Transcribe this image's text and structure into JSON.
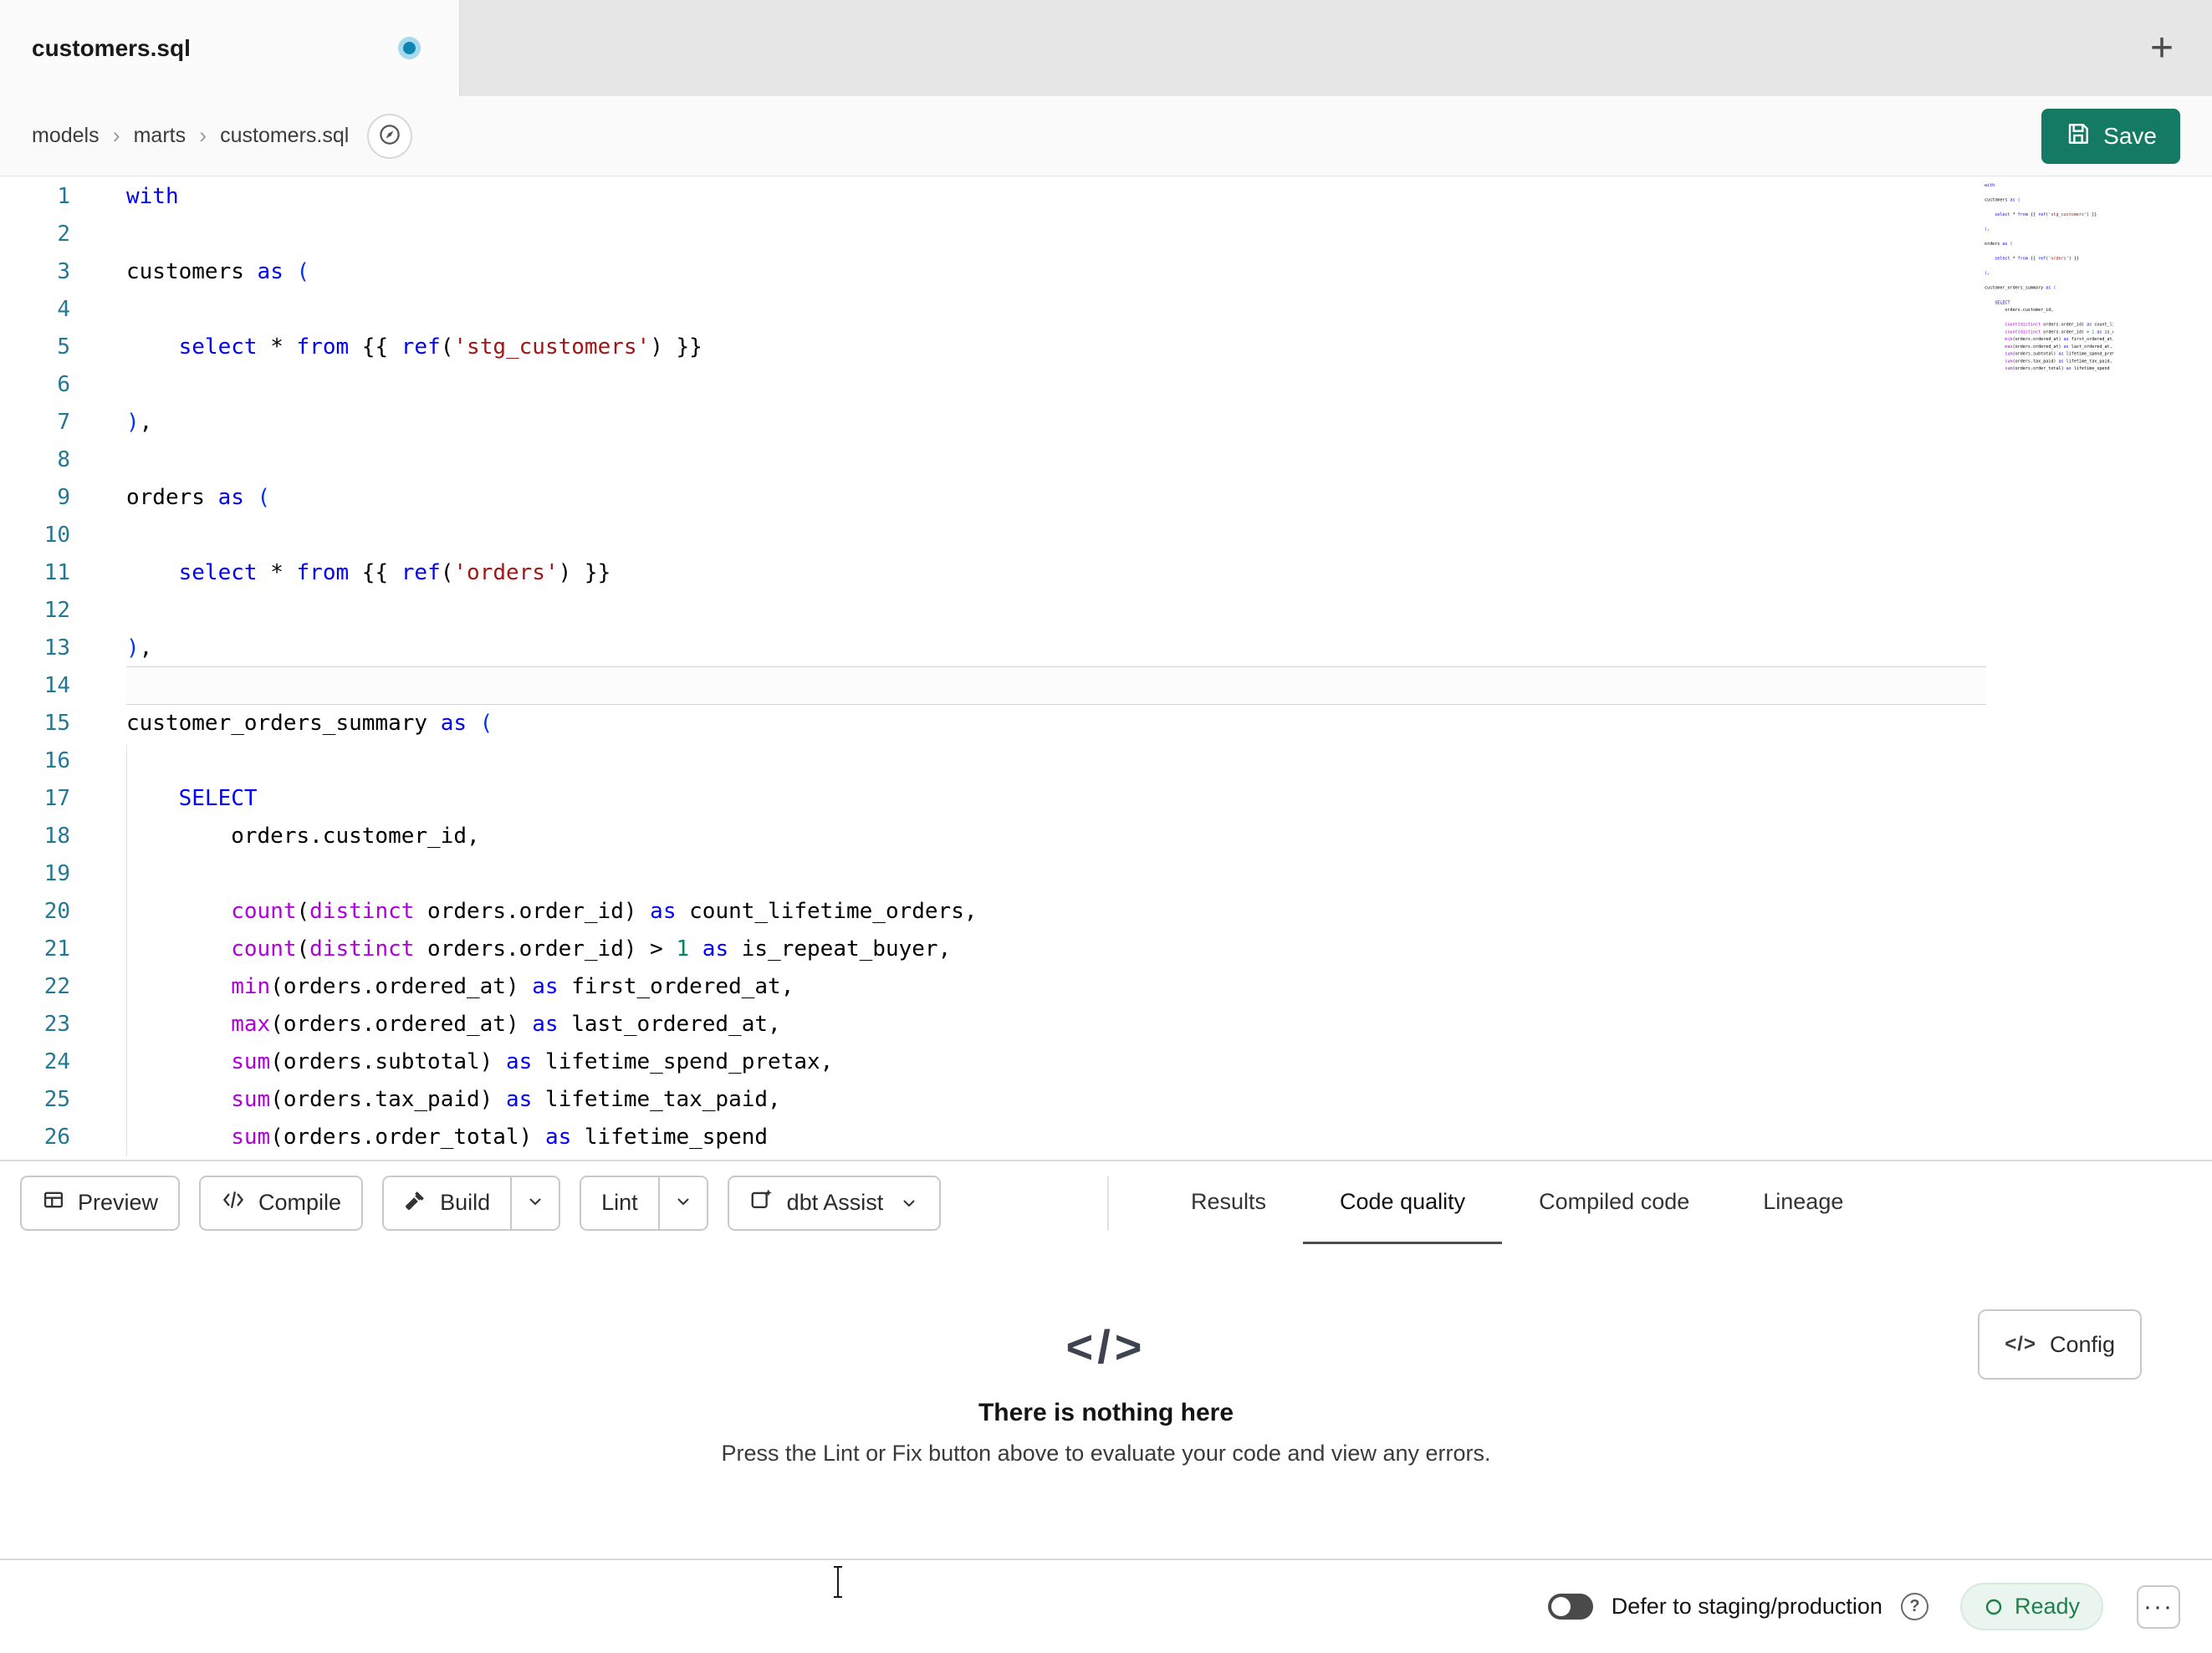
{
  "colors": {
    "accent_save": "#147a63",
    "kw": "#0000ff",
    "fn": "#af00db",
    "str": "#a31515",
    "num": "#098658",
    "br": "#0431fa",
    "line_number": "#237893",
    "ready_green": "#1d7f4c"
  },
  "icons": {
    "plus": "+",
    "breadcrumb_sep": "›",
    "code": "</>",
    "help": "?",
    "menu": "···"
  },
  "tab_bar": {
    "tab_title": "customers.sql"
  },
  "breadcrumb": {
    "items": [
      "models",
      "marts",
      "customers.sql"
    ]
  },
  "header": {
    "save_label": "Save"
  },
  "editor": {
    "active_line": 14,
    "lines": [
      [
        [
          "kw",
          "with"
        ]
      ],
      [],
      [
        [
          "id",
          "customers "
        ],
        [
          "kw",
          "as"
        ],
        [
          "id",
          " "
        ],
        [
          "br",
          "("
        ]
      ],
      [],
      [
        [
          "id",
          "    "
        ],
        [
          "kw",
          "select"
        ],
        [
          "id",
          " * "
        ],
        [
          "kw",
          "from"
        ],
        [
          "id",
          " {{ "
        ],
        [
          "kw",
          "ref"
        ],
        [
          "id",
          "("
        ],
        [
          "str",
          "'stg_customers'"
        ],
        [
          "id",
          ") }}"
        ]
      ],
      [],
      [
        [
          "br",
          ")"
        ],
        [
          "id",
          ","
        ]
      ],
      [],
      [
        [
          "id",
          "orders "
        ],
        [
          "kw",
          "as"
        ],
        [
          "id",
          " "
        ],
        [
          "br",
          "("
        ]
      ],
      [],
      [
        [
          "id",
          "    "
        ],
        [
          "kw",
          "select"
        ],
        [
          "id",
          " * "
        ],
        [
          "kw",
          "from"
        ],
        [
          "id",
          " {{ "
        ],
        [
          "kw",
          "ref"
        ],
        [
          "id",
          "("
        ],
        [
          "str",
          "'orders'"
        ],
        [
          "id",
          ") }}"
        ]
      ],
      [],
      [
        [
          "br",
          ")"
        ],
        [
          "id",
          ","
        ]
      ],
      [],
      [
        [
          "id",
          "customer_orders_summary "
        ],
        [
          "kw",
          "as"
        ],
        [
          "id",
          " "
        ],
        [
          "br",
          "("
        ]
      ],
      [],
      [
        [
          "id",
          "    "
        ],
        [
          "kw",
          "SELECT"
        ]
      ],
      [
        [
          "id",
          "        orders.customer_id,"
        ]
      ],
      [],
      [
        [
          "id",
          "        "
        ],
        [
          "fn",
          "count"
        ],
        [
          "id",
          "("
        ],
        [
          "fn",
          "distinct"
        ],
        [
          "id",
          " orders.order_id) "
        ],
        [
          "kw",
          "as"
        ],
        [
          "id",
          " count_lifetime_orders,"
        ]
      ],
      [
        [
          "id",
          "        "
        ],
        [
          "fn",
          "count"
        ],
        [
          "id",
          "("
        ],
        [
          "fn",
          "distinct"
        ],
        [
          "id",
          " orders.order_id) > "
        ],
        [
          "num",
          "1"
        ],
        [
          "id",
          " "
        ],
        [
          "kw",
          "as"
        ],
        [
          "id",
          " is_repeat_buyer,"
        ]
      ],
      [
        [
          "id",
          "        "
        ],
        [
          "fn",
          "min"
        ],
        [
          "id",
          "(orders.ordered_at) "
        ],
        [
          "kw",
          "as"
        ],
        [
          "id",
          " first_ordered_at,"
        ]
      ],
      [
        [
          "id",
          "        "
        ],
        [
          "fn",
          "max"
        ],
        [
          "id",
          "(orders.ordered_at) "
        ],
        [
          "kw",
          "as"
        ],
        [
          "id",
          " last_ordered_at,"
        ]
      ],
      [
        [
          "id",
          "        "
        ],
        [
          "fn",
          "sum"
        ],
        [
          "id",
          "(orders.subtotal) "
        ],
        [
          "kw",
          "as"
        ],
        [
          "id",
          " lifetime_spend_pretax,"
        ]
      ],
      [
        [
          "id",
          "        "
        ],
        [
          "fn",
          "sum"
        ],
        [
          "id",
          "(orders.tax_paid) "
        ],
        [
          "kw",
          "as"
        ],
        [
          "id",
          " lifetime_tax_paid,"
        ]
      ],
      [
        [
          "id",
          "        "
        ],
        [
          "fn",
          "sum"
        ],
        [
          "id",
          "(orders.order_total) "
        ],
        [
          "kw",
          "as"
        ],
        [
          "id",
          " lifetime_spend"
        ]
      ]
    ]
  },
  "toolbar": {
    "preview_label": "Preview",
    "compile_label": "Compile",
    "build_label": "Build",
    "lint_label": "Lint",
    "assist_label": "dbt Assist",
    "tabs": [
      {
        "label": "Results",
        "active": false
      },
      {
        "label": "Code quality",
        "active": true
      },
      {
        "label": "Compiled code",
        "active": false
      },
      {
        "label": "Lineage",
        "active": false
      }
    ]
  },
  "panel": {
    "empty_icon": "</>",
    "empty_title": "There is nothing here",
    "empty_subtitle": "Press the Lint or Fix button above to evaluate your code and view any errors.",
    "config_label": "Config"
  },
  "status_bar": {
    "defer_label": "Defer to staging/production",
    "ready_label": "Ready"
  }
}
